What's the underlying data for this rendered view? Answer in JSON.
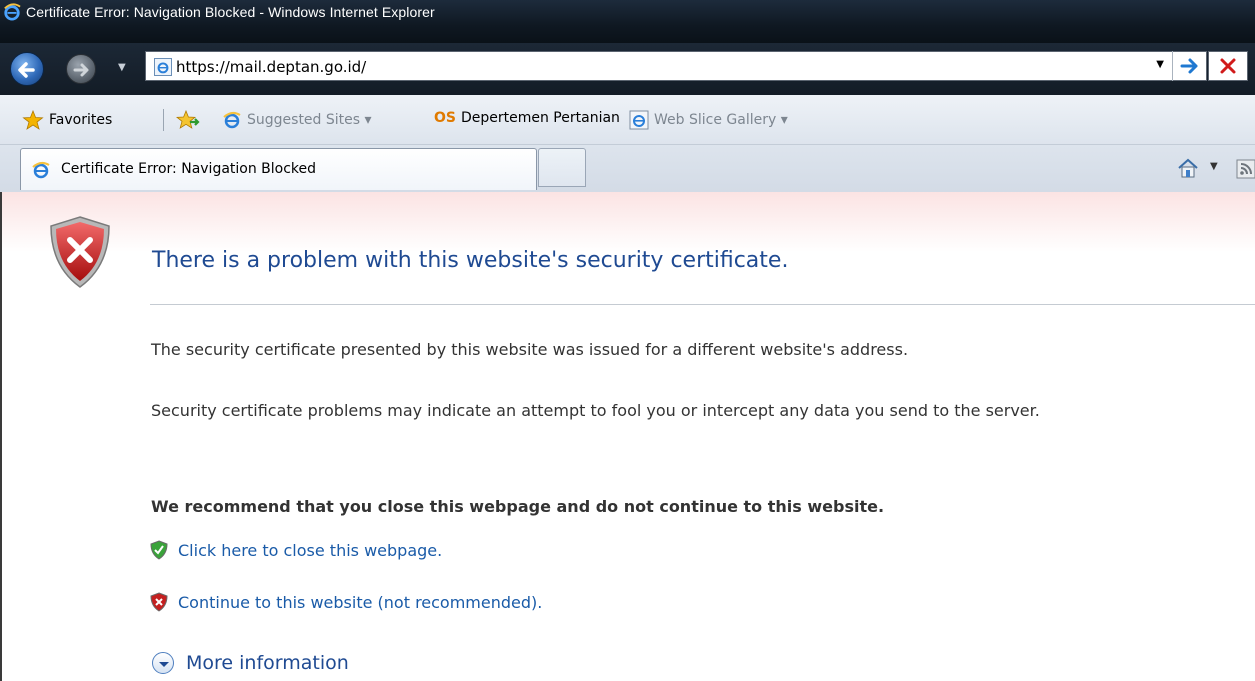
{
  "window": {
    "title": "Certificate Error: Navigation Blocked - Windows Internet Explorer"
  },
  "navbar": {
    "url": "https://mail.deptan.go.id/"
  },
  "favorites_bar": {
    "favorites_label": "Favorites",
    "items": [
      {
        "label": "Suggested Sites ▾",
        "icon": "ie-icon"
      },
      {
        "label": "Depertemen Pertanian",
        "icon": "os-badge",
        "badge": "OS"
      },
      {
        "label": "Web Slice Gallery ▾",
        "icon": "ie-page-icon"
      }
    ]
  },
  "tabs": [
    {
      "label": "Certificate Error: Navigation Blocked",
      "active": true
    }
  ],
  "content": {
    "heading": "There is a problem with this website's security certificate.",
    "paragraph1": "The security certificate presented by this website was issued for a different website's address.",
    "paragraph2": "Security certificate problems may indicate an attempt to fool you or intercept any data you send to the server.",
    "recommendation": "We recommend that you close this webpage and do not continue to this website.",
    "close_link": "Click here to close this webpage.",
    "continue_link": "Continue to this website (not recommended).",
    "more_info": "More information"
  },
  "colors": {
    "heading": "#1f4a92",
    "link": "#1a5ba8",
    "error_red": "#c42020",
    "ok_green": "#2e9a2e"
  }
}
